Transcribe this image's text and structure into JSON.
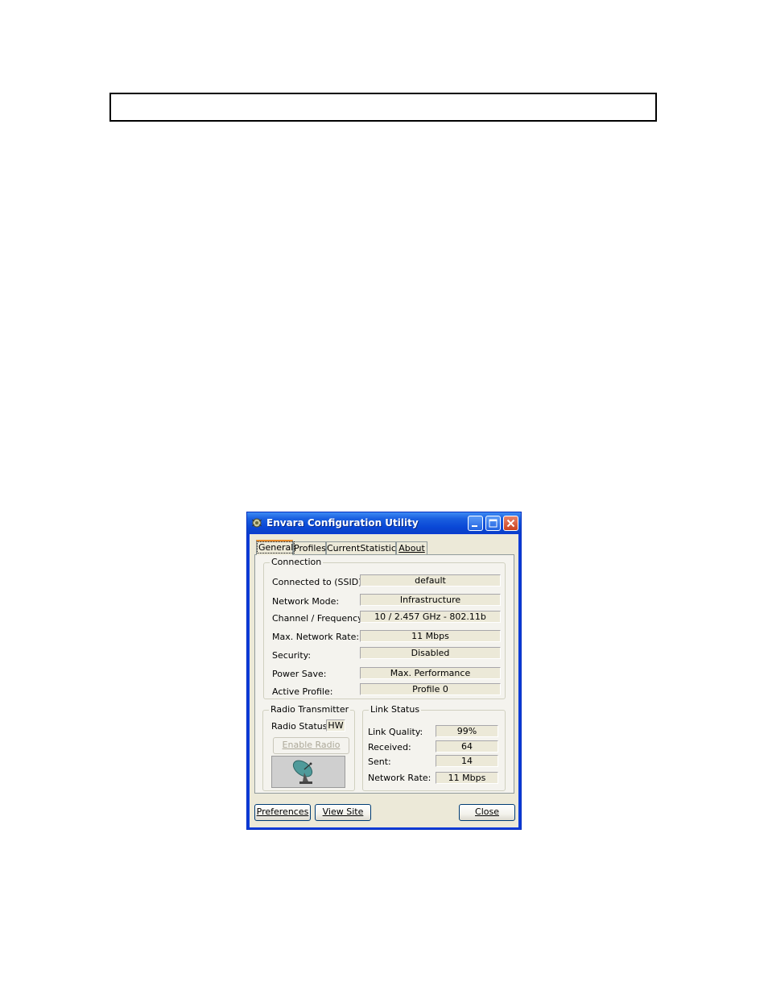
{
  "window": {
    "title": "Envara Configuration Utility",
    "colors": {
      "titlebar": "#0a48d6",
      "face": "#ece9d8",
      "accent_tab": "#e68b2c"
    }
  },
  "tabs": [
    {
      "label": "General",
      "active": true
    },
    {
      "label": "Profiles",
      "active": false
    },
    {
      "label": "CurrentStatistics",
      "active": false
    },
    {
      "label": "About",
      "active": false
    }
  ],
  "connection": {
    "title": "Connection",
    "rows": [
      {
        "label": "Connected to (SSID)",
        "value": "default"
      },
      {
        "label": "Network Mode:",
        "value": "Infrastructure"
      },
      {
        "label": "Channel / Frequency:",
        "value": "10 / 2.457 GHz - 802.11b"
      },
      {
        "label": "Max. Network Rate:",
        "value": "11 Mbps"
      },
      {
        "label": "Security:",
        "value": "Disabled"
      },
      {
        "label": "Power Save:",
        "value": "Max. Performance"
      },
      {
        "label": "Active Profile:",
        "value": "Profile 0"
      }
    ]
  },
  "radio": {
    "title": "Radio Transmitter",
    "status_label": "Radio Status:",
    "status_value": "HW",
    "enable_button": "Enable Radio",
    "icon": "satellite-dish-icon"
  },
  "link_status": {
    "title": "Link Status",
    "rows": [
      {
        "label": "Link Quality:",
        "value": "99%"
      },
      {
        "label": "Received:",
        "value": "64"
      },
      {
        "label": "Sent:",
        "value": "14"
      },
      {
        "label": "Network Rate:",
        "value": "11 Mbps"
      }
    ]
  },
  "buttons": {
    "preferences": "Preferences",
    "view_site": "View Site",
    "close": "Close"
  }
}
